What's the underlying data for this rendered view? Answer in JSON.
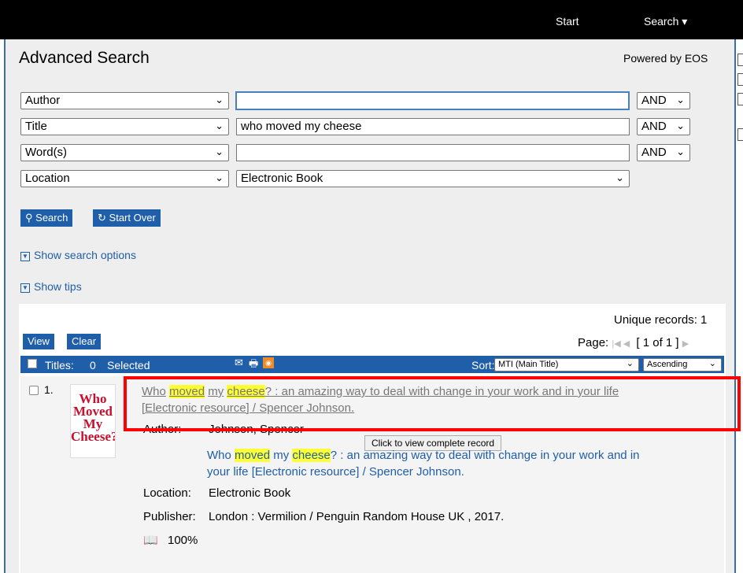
{
  "nav": {
    "start": "Start",
    "search": "Search"
  },
  "header": {
    "title": "Advanced Search",
    "powered": "Powered by EOS"
  },
  "rows": [
    {
      "field": "Author",
      "value": "",
      "op": "AND"
    },
    {
      "field": "Title",
      "value": "who moved my cheese",
      "op": "AND"
    },
    {
      "field": "Word(s)",
      "value": "",
      "op": "AND"
    },
    {
      "field": "Location",
      "value": "Electronic Book"
    }
  ],
  "buttons": {
    "search": "Search",
    "start_over": "Start Over"
  },
  "links": {
    "options": "Show search options",
    "tips": "Show tips"
  },
  "results": {
    "unique": "Unique records: 1",
    "view": "View",
    "clear": "Clear",
    "page_label": "Page:",
    "page_value": "[ 1 of 1 ]",
    "titles_label": "Titles:",
    "selected_count": "0",
    "selected_label": "Selected",
    "sort_label": "Sort:",
    "sort_value": "MTI (Main Title)",
    "order_value": "Ascending"
  },
  "record": {
    "number": "1.",
    "cover_text": "Who Moved My Cheese?",
    "t_who": "Who",
    "t_moved": "moved",
    "t_my": "my",
    "t_cheese": "cheese",
    "t_rest1": "? : an amazing way to deal with change in your work and in your life",
    "t_rest2": "[Electronic resource] / Spencer Johnson.",
    "author_label": "Author:",
    "author_value": "Johnson, Spencer",
    "tooltip": "Click to view complete record",
    "b_rest1": "? : an amazing way to deal with change in your work and in",
    "b_rest2": "your life [Electronic resource] / Spencer Johnson.",
    "location_label": "Location:",
    "location_value": "Electronic Book",
    "publisher_label": "Publisher:",
    "publisher_value": "London : Vermilion / Penguin Random House UK , 2017.",
    "percent": "100%"
  }
}
